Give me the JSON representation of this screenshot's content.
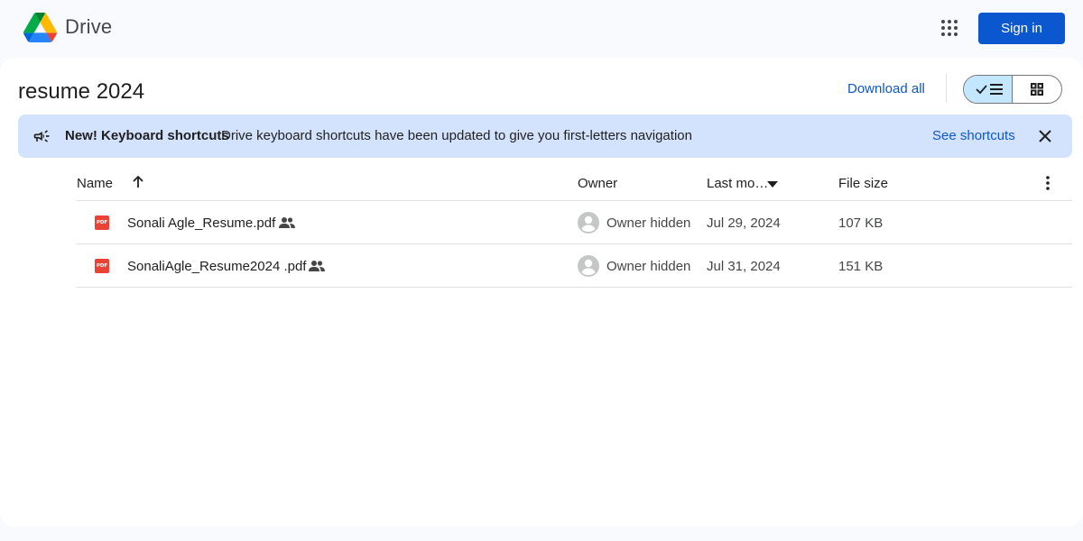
{
  "header": {
    "app_name": "Drive",
    "sign_in_label": "Sign in"
  },
  "folder": {
    "title": "resume 2024",
    "download_all_label": "Download all"
  },
  "banner": {
    "title": "New! Keyboard shortcuts",
    "text": "Drive keyboard shortcuts have been updated to give you first-letters navigation",
    "link_label": "See shortcuts"
  },
  "table": {
    "columns": {
      "name": "Name",
      "owner": "Owner",
      "modified": "Last mo…",
      "size": "File size"
    },
    "rows": [
      {
        "name": "Sonali Agle_Resume.pdf",
        "file_type_label": "PDF",
        "owner": "Owner hidden",
        "modified": "Jul 29, 2024",
        "size": "107 KB",
        "shared": true
      },
      {
        "name": "SonaliAgle_Resume2024 .pdf",
        "file_type_label": "PDF",
        "owner": "Owner hidden",
        "modified": "Jul 31, 2024",
        "size": "151 KB",
        "shared": true
      }
    ]
  },
  "colors": {
    "accent": "#0b57d0",
    "banner_bg": "#d3e3fd",
    "toggle_active": "#c2e7ff",
    "pdf_red": "#ea4335"
  },
  "icons": {
    "logo": "google-drive-logo",
    "apps": "apps-grid-icon",
    "list_view": "list-view-icon",
    "grid_view": "grid-view-icon",
    "banner": "megaphone-icon",
    "close": "close-icon",
    "sort": "arrow-up-icon",
    "more": "more-vert-icon",
    "shared": "people-icon",
    "avatar": "account-circle-icon"
  }
}
